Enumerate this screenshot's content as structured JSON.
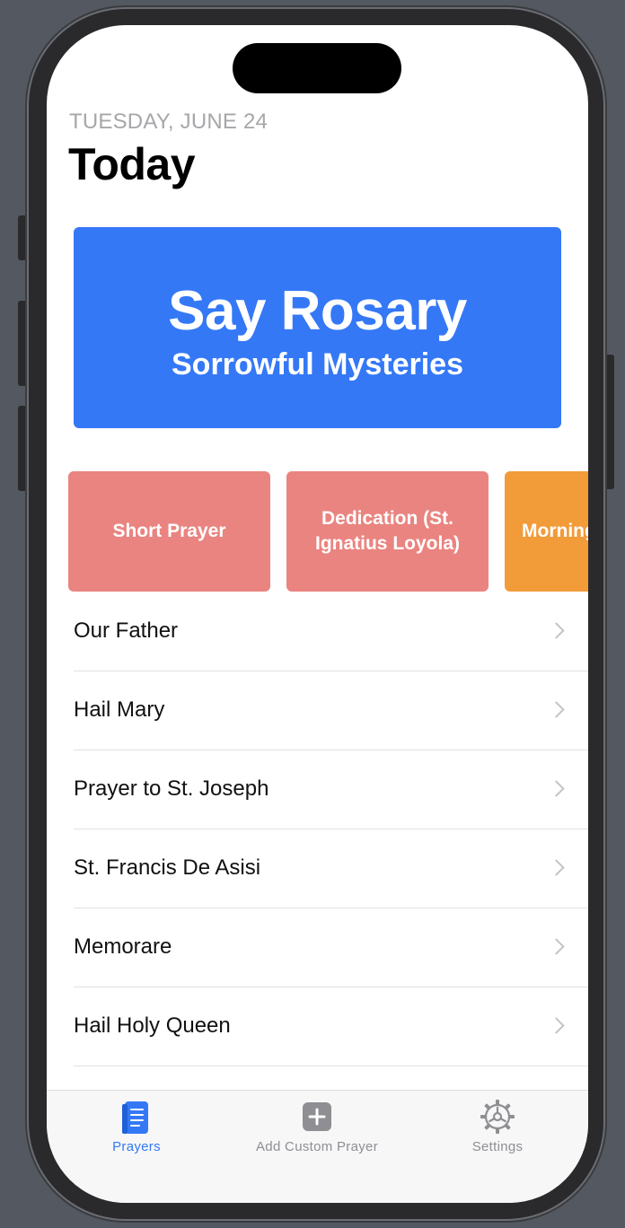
{
  "header": {
    "date": "TUESDAY, JUNE 24",
    "title": "Today"
  },
  "hero": {
    "title": "Say Rosary",
    "subtitle": "Sorrowful Mysteries",
    "color": "#3478f6"
  },
  "cards": [
    {
      "label": "Short Prayer",
      "color": "#ea8480"
    },
    {
      "label": "Dedication (St. Ignatius Loyola)",
      "color": "#ea8480"
    },
    {
      "label": "Morning",
      "color": "#f29b39"
    }
  ],
  "prayers": [
    "Our Father",
    "Hail Mary",
    "Prayer to St. Joseph",
    "St. Francis De Asisi",
    "Memorare",
    "Hail Holy Queen"
  ],
  "tabbar": {
    "tabs": [
      {
        "label": "Prayers",
        "icon": "book-icon",
        "active": true
      },
      {
        "label": "Add Custom Prayer",
        "icon": "plus-square-icon",
        "active": false
      },
      {
        "label": "Settings",
        "icon": "gear-icon",
        "active": false
      }
    ],
    "active_color": "#3478f6",
    "inactive_color": "#8e8e93"
  }
}
